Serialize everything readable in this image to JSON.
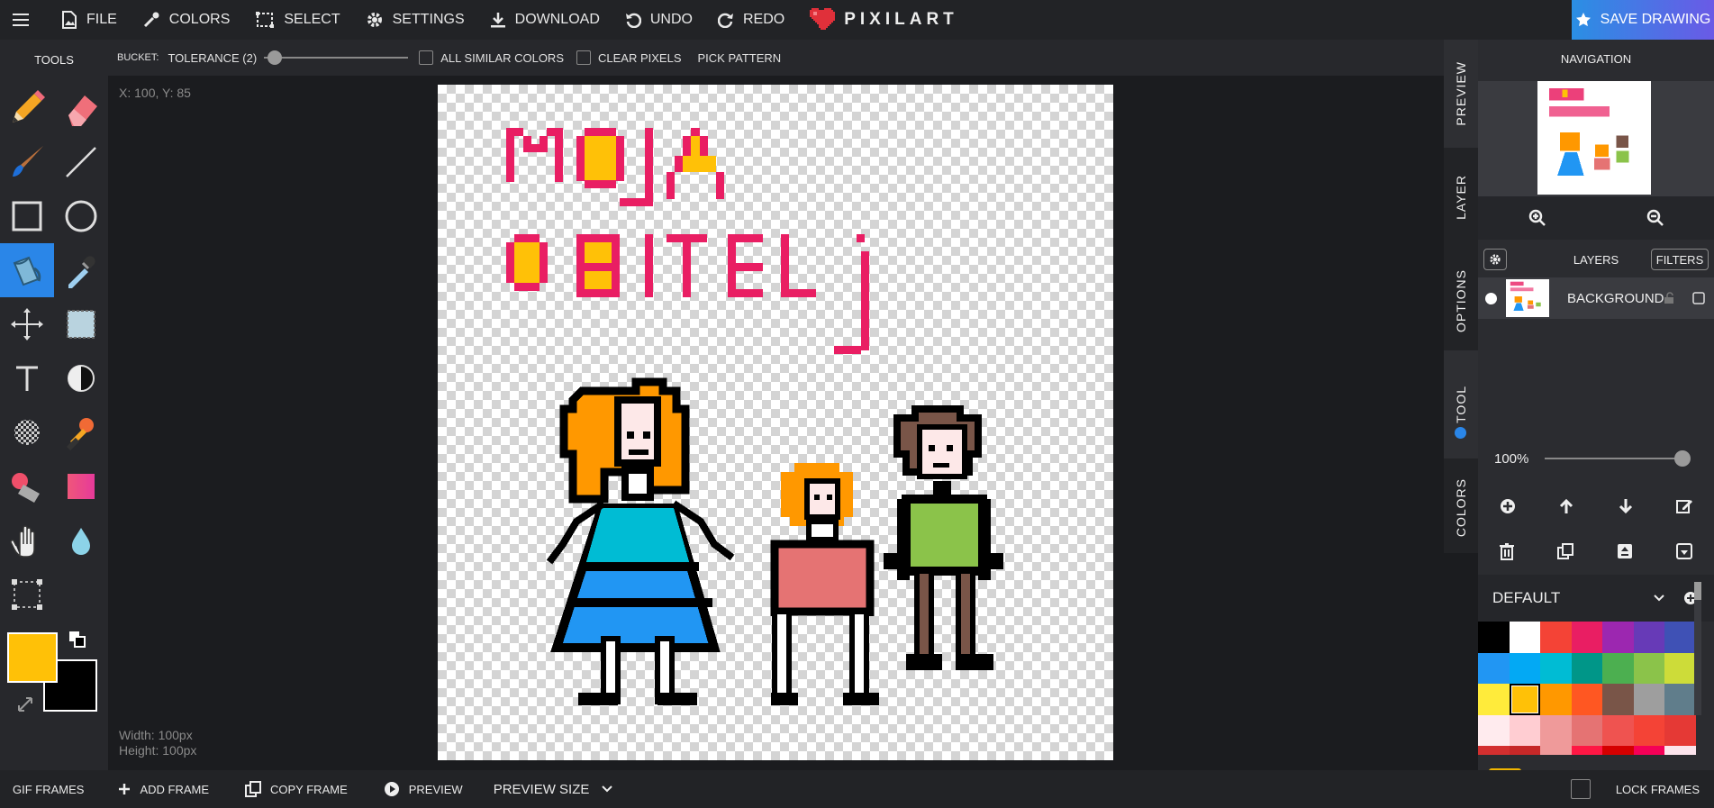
{
  "topbar": {
    "file": "FILE",
    "colors": "COLORS",
    "select": "SELECT",
    "settings": "SETTINGS",
    "download": "DOWNLOAD",
    "undo": "UNDO",
    "redo": "REDO",
    "logo": "PIXILART",
    "save": "SAVE DRAWING"
  },
  "tool_options": {
    "tool_label": "BUCKET:",
    "tolerance": "TOLERANCE (2)",
    "all_similar": "ALL SIMILAR COLORS",
    "clear_pixels": "CLEAR PIXELS",
    "pick_pattern": "PICK PATTERN"
  },
  "toolbar": {
    "title": "TOOLS",
    "active_tool": "bucket",
    "primary_color": "#FFC107",
    "secondary_color": "#000000"
  },
  "canvas": {
    "coordinates": "X: 100, Y: 85",
    "width": "Width: 100px",
    "height": "Height: 100px"
  },
  "side_tabs": [
    "PREVIEW",
    "LAYER",
    "OPTIONS",
    "TOOL",
    "COLORS"
  ],
  "navigation": {
    "title": "NAVIGATION"
  },
  "layers": {
    "title": "LAYERS",
    "filters": "FILTERS",
    "items": [
      {
        "name": "BACKGROUND"
      }
    ],
    "opacity": "100%"
  },
  "palette": {
    "name": "DEFAULT",
    "colors": [
      "#000000",
      "#FFFFFF",
      "#F44336",
      "#E91E63",
      "#9C27B0",
      "#673AB7",
      "#3F51B5",
      "#2196F3",
      "#03A9F4",
      "#00BCD4",
      "#009688",
      "#4CAF50",
      "#8BC34A",
      "#CDDC39",
      "#FFEB3B",
      "#FFC107",
      "#FF9800",
      "#FF5722",
      "#795548",
      "#9E9E9E",
      "#607D8B",
      "#FFEBEE",
      "#FFCDD2",
      "#EF9A9A",
      "#E57373",
      "#EF5350",
      "#F44336",
      "#E53935",
      "#D32F2F",
      "#C62828",
      "#EF9A9A",
      "#FF1744",
      "#D50000",
      "#F50057",
      "#FCE4EC"
    ],
    "selected_index": 15
  },
  "brush": {
    "size": "1"
  },
  "bottombar": {
    "gif_frames": "GIF FRAMES",
    "add_frame": "ADD FRAME",
    "copy_frame": "COPY FRAME",
    "preview": "PREVIEW",
    "preview_size": "PREVIEW SIZE",
    "lock_frames": "LOCK FRAMES"
  }
}
